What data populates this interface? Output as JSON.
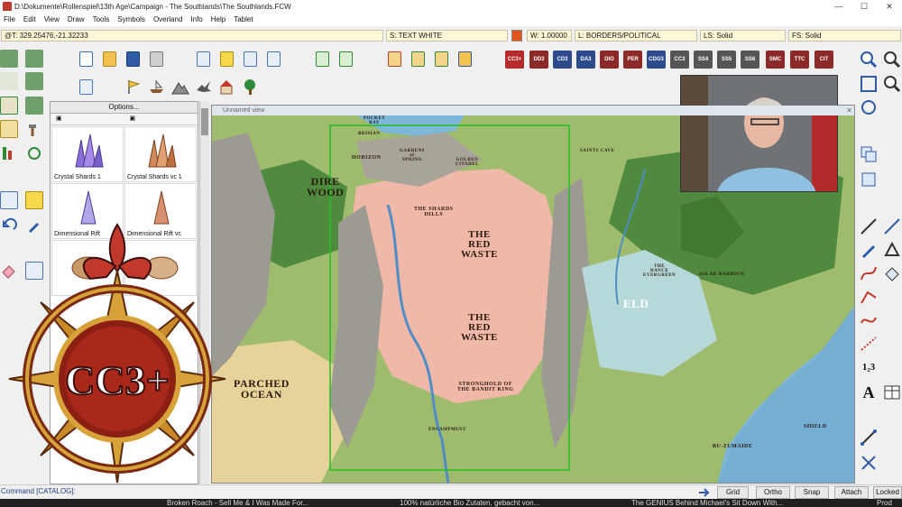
{
  "window": {
    "title": "D:\\Dokumente\\Rollenspiel\\13th Age\\Campaign - The Southlands\\The Southlands.FCW",
    "controls": [
      "—",
      "☐",
      "✕"
    ]
  },
  "menu": [
    "File",
    "Edit",
    "View",
    "Draw",
    "Tools",
    "Symbols",
    "Overland",
    "Info",
    "Help",
    "Tablet"
  ],
  "status": {
    "coords": "@T: 329.25476,-21.32233",
    "sheet": "S: TEXT WHITE",
    "width": "W: 1.00000",
    "layer": "L: BORDERS/POLITICAL",
    "line_style": "LS: Solid",
    "fill_style": "FS: Solid"
  },
  "colors": {
    "current": "#e2561d",
    "accent": "#c0392b"
  },
  "cc_buttons": [
    "CC3+",
    "DD3",
    "CD3",
    "DA3",
    "DIO",
    "PER",
    "CDG3",
    "CC3",
    "SS4",
    "SS5",
    "SS6",
    "SMC",
    "TTC",
    "CIT"
  ],
  "catalog": {
    "options_label": "Options...",
    "items": [
      {
        "label": "Crystal Shards 1"
      },
      {
        "label": "Crystal Shards vc 1"
      },
      {
        "label": "Dimensional Rift"
      },
      {
        "label": "Dimensional Rift vc"
      }
    ]
  },
  "map": {
    "view_title": "Unnamed view",
    "labels": {
      "pocket_bay": "POCKET\nBAY",
      "brisian": "BRISIAN",
      "horizon": "HORIZON",
      "gardens": "GARDENS\nof\nSPRING",
      "citadel": "GOLDEN\nCITADEL",
      "dire_wood": "DIRE\nWOOD",
      "hills": "THE SHARDS\nHILLS",
      "red_waste_1": "THE\nRED\nWASTE",
      "red_waste_2": "THE\nRED\nWASTE",
      "stronghold": "STRONGHOLD OF\nTHE BANDIT KING",
      "encampment": "ENCAMPMENT",
      "parched": "PARCHED\nOCEAN",
      "eld": "ELD",
      "dance": "THE\nDANCE\nEVERGREEN",
      "saints": "SAINTS CAVE",
      "shield": "SHIELD",
      "bu": "BU-ZUMAIDE",
      "solar": "SOLAR HARBOUR"
    }
  },
  "logo": {
    "text": "CC3+"
  },
  "right_tools": {
    "text_tool": "A",
    "ordinal_tool": "1₂3"
  },
  "command_line": "Command [CATALOG]:",
  "bottom_buttons": [
    "Grid",
    "Ortho",
    "Snap",
    "Attach",
    "Locked"
  ],
  "taskbar": [
    "Broken Roach - Sell Me & I Was Made For...",
    "100% natürliche Bio Zutaten, gebacht von...",
    "The GENIUS Behind Michael's Sit Down With...",
    "Prod"
  ]
}
